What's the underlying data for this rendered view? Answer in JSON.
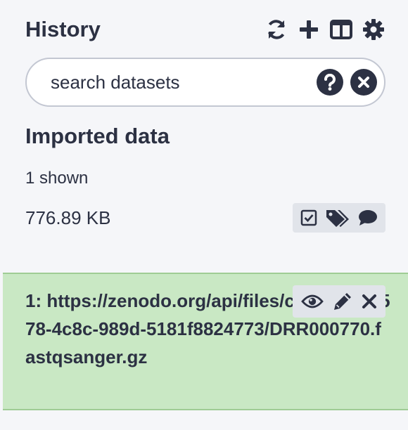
{
  "panel": {
    "title": "History"
  },
  "toolbar": {
    "icons": [
      "refresh-icon",
      "plus-icon",
      "columns-icon",
      "gear-icon"
    ]
  },
  "search": {
    "placeholder": "search datasets",
    "value": ""
  },
  "history": {
    "name": "Imported data",
    "shown": "1 shown",
    "size": "776.89 KB"
  },
  "dataset": {
    "title": "1: https://zenodo.org/api/files/c07c0fbd-c578-4c8c-989d-5181f8824773/DRR000770.fastqsanger.gz",
    "state_color": "#c9e8c4"
  },
  "colors": {
    "text": "#2c3143",
    "background": "#f5f6f9",
    "ok_state": "#c9e8c4"
  }
}
